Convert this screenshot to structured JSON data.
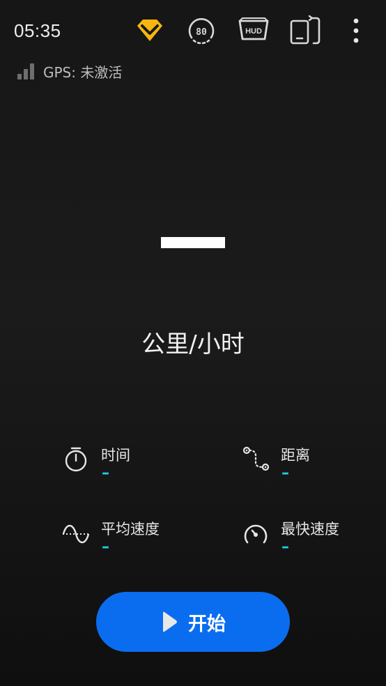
{
  "status_bar": {
    "time": "05:35"
  },
  "toolbar": {
    "icons": [
      "vip-diamond-icon",
      "speed-limit-icon",
      "hud-icon",
      "screen-rotate-icon",
      "more-vert-icon"
    ],
    "hud_text": "HUD",
    "speed_limit_text": "80"
  },
  "gps": {
    "label": "GPS: 未激活"
  },
  "speedometer": {
    "value": "—",
    "unit": "公里/小时"
  },
  "stats": {
    "time": {
      "label": "时间",
      "value": "–"
    },
    "distance": {
      "label": "距离",
      "value": "–"
    },
    "avg_speed": {
      "label": "平均速度",
      "value": "–"
    },
    "max_speed": {
      "label": "最快速度",
      "value": "–"
    }
  },
  "start_button": {
    "label": "开始"
  },
  "colors": {
    "accent_blue": "#0a6df0",
    "stat_value_cyan": "#1ecfe4",
    "vip_gold": "#f5b60f"
  }
}
